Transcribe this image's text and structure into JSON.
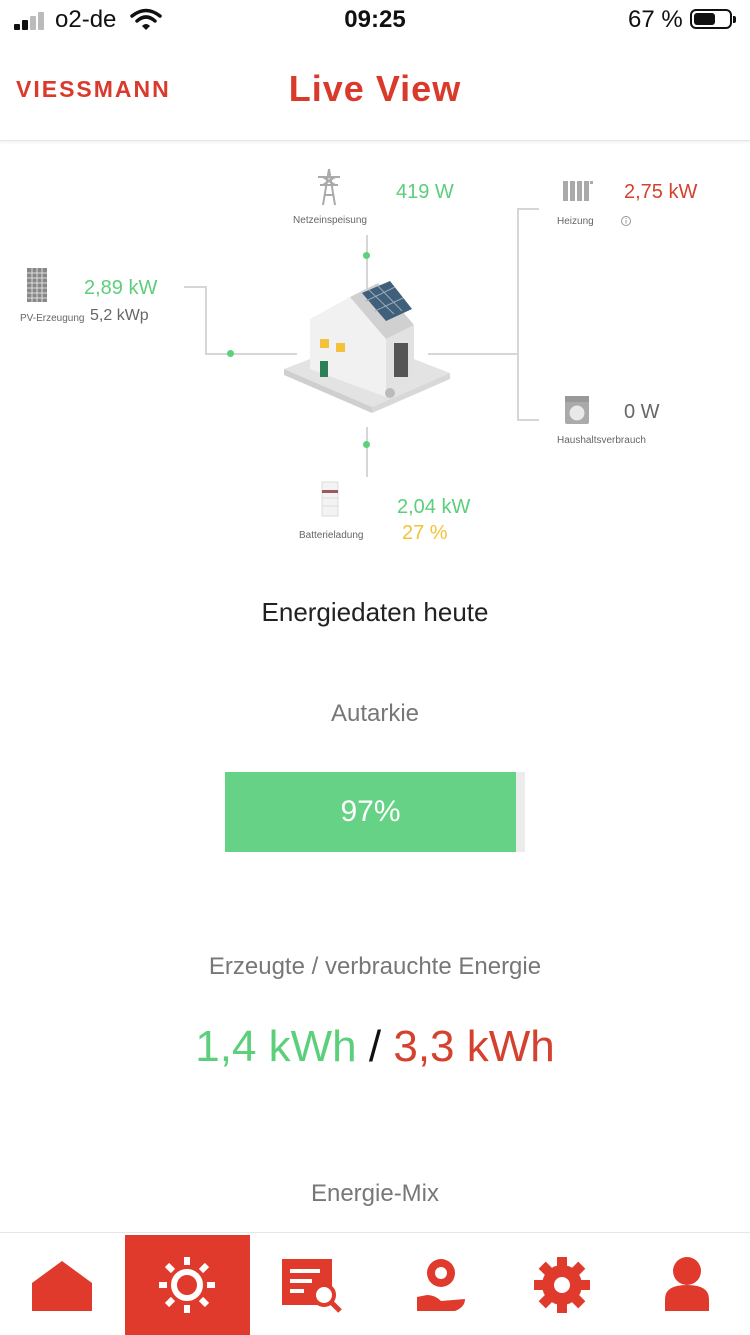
{
  "status_bar": {
    "carrier": "o2-de",
    "time": "09:25",
    "battery": "67 %",
    "battery_level": 0.67
  },
  "header": {
    "logo": "VIESSMANN",
    "title": "Live View"
  },
  "diagram": {
    "grid": {
      "value": "419 W",
      "label": "Netzeinspeisung"
    },
    "heating": {
      "value": "2,75 kW",
      "label": "Heizung",
      "info_icon": "info-icon"
    },
    "pv": {
      "value": "2,89 kW",
      "peak": "5,2 kWp",
      "label": "PV-Erzeugung"
    },
    "household": {
      "value": "0 W",
      "label": "Haushaltsverbrauch"
    },
    "battery": {
      "value": "2,04 kW",
      "percent": "27 %",
      "label": "Batterieladung"
    }
  },
  "energy_today": {
    "title": "Energiedaten heute",
    "autarky_label": "Autarkie",
    "autarky_value": "97%",
    "autarky_fraction": 0.97,
    "energy_label": "Erzeugte / verbrauchte Energie",
    "produced": "1,4 kWh",
    "separator": "/",
    "consumed": "3,3 kWh",
    "mix_label": "Energie-Mix"
  },
  "colors": {
    "brand": "#d93a2b",
    "green": "#5bcf7a",
    "red": "#d4412f",
    "yellow": "#f2c23b",
    "bar_green": "#66d285"
  },
  "nav": [
    {
      "icon": "home-icon"
    },
    {
      "icon": "sun-icon",
      "active": true
    },
    {
      "icon": "search-list-icon"
    },
    {
      "icon": "hand-coin-icon"
    },
    {
      "icon": "gear-icon"
    },
    {
      "icon": "user-icon"
    }
  ]
}
